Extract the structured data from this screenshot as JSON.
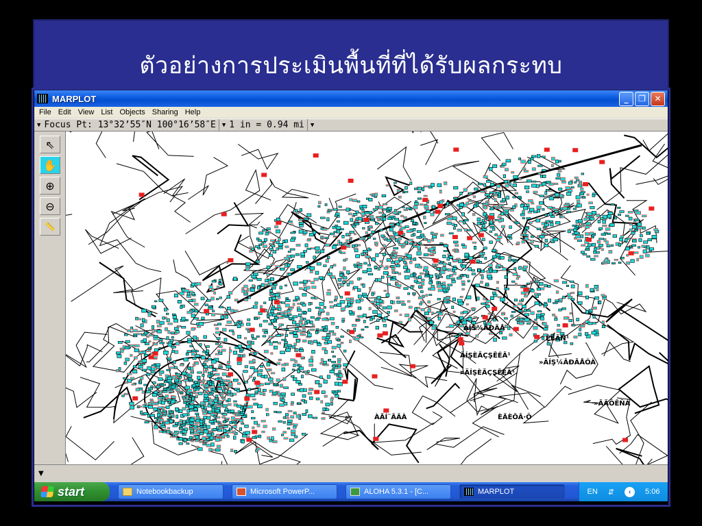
{
  "slide": {
    "title": "ตัวอย่างการประเมินพื้นที่ที่ได้รับผลกระทบ"
  },
  "window": {
    "title": "MARPLOT",
    "minimize": "_",
    "maximize": "❐",
    "close": "✕"
  },
  "menubar": {
    "items": [
      "File",
      "Edit",
      "View",
      "List",
      "Objects",
      "Sharing",
      "Help"
    ]
  },
  "infobar": {
    "focus": "Focus Pt: 13°32’55″N 100°16’58″E",
    "scale": "1 in = 0.94 mi"
  },
  "toolbox": {
    "tools": [
      {
        "name": "arrow",
        "glyph": "⇖",
        "active": false
      },
      {
        "name": "hand",
        "glyph": "✋",
        "active": true
      },
      {
        "name": "zoom-in",
        "glyph": "⊕",
        "active": false
      },
      {
        "name": "zoom-out",
        "glyph": "⊖",
        "active": false
      },
      {
        "name": "ruler",
        "glyph": "📏",
        "active": false
      }
    ]
  },
  "map": {
    "labels": [
      "ÄÍS¾ÂÐÃÅ",
      "ÄÍŞÈÃÇŞÊÉÂ¹",
      "¤ÄÍŞÈÃÇŞÊÉÂ¹",
      "»ÄÍŞ¼ÂÐÃÅÓÀ",
      "»ÃÃÔÊÑÁ",
      "ÊËÃÑ¹",
      "ÈÃÈÕÃ·Ô",
      "ÀÃÍ¨ÃÃÀ"
    ],
    "colors": {
      "affected": "#20d8d8",
      "marker": "#e82020",
      "ink": "#000000",
      "background": "#ffffff"
    }
  },
  "taskbar": {
    "start": "start",
    "tasks": [
      {
        "label": "Notebookbackup",
        "icon": "folder-icon"
      },
      {
        "label": "Microsoft PowerP...",
        "icon": "powerpoint-icon"
      },
      {
        "label": "ALOHA 5.3.1 - [C...",
        "icon": "aloha-icon"
      },
      {
        "label": "MARPLOT",
        "icon": "marplot-icon"
      }
    ],
    "tray": {
      "lang": "EN",
      "time": "5:06"
    }
  }
}
